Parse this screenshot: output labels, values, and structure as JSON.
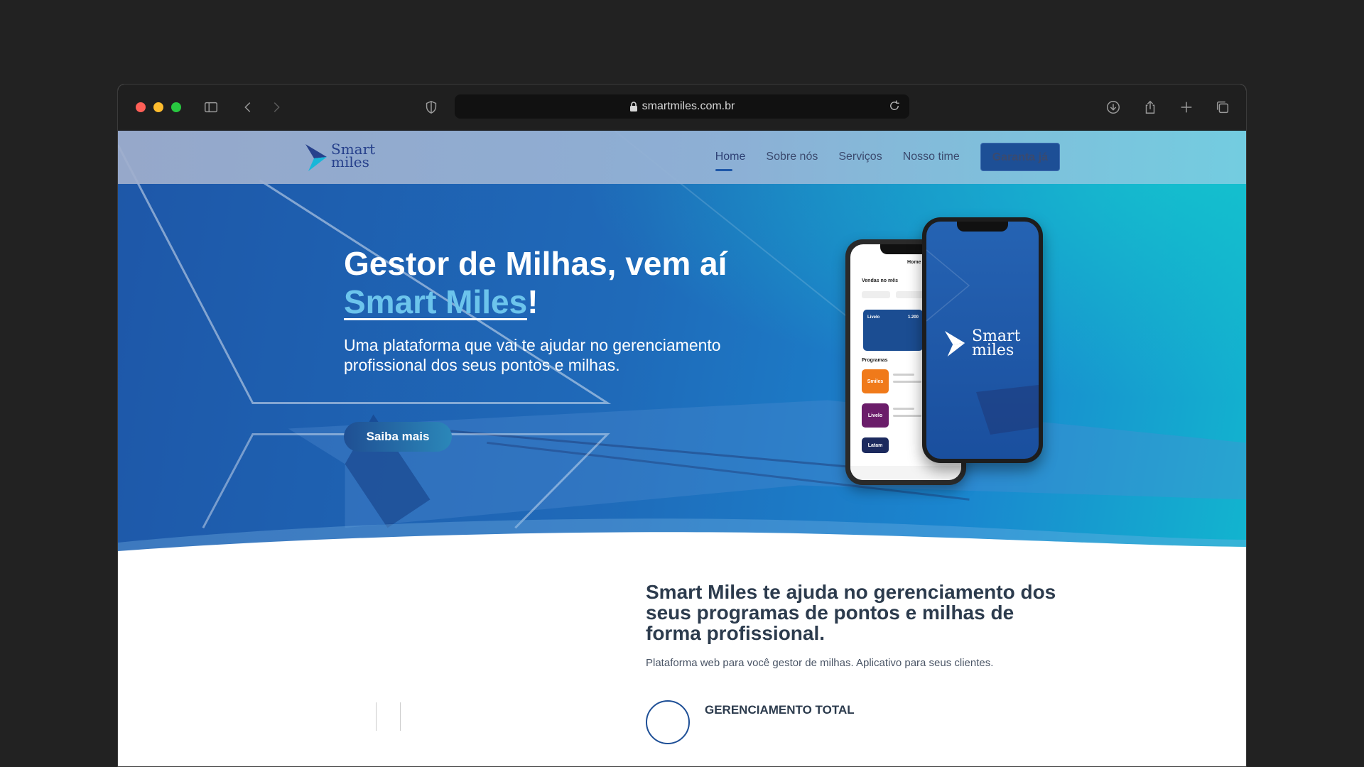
{
  "browser": {
    "url": "smartmiles.com.br"
  },
  "site": {
    "logo": {
      "line1": "Smart",
      "line2": "miles"
    },
    "nav": {
      "items": [
        "Home",
        "Sobre nós",
        "Serviços",
        "Nosso time"
      ],
      "cta": "Garanta já"
    },
    "hero": {
      "title_line1": "Gestor de Milhas, vem aí",
      "title_accent": "Smart Miles",
      "title_suffix": "!",
      "subtitle": "Uma plataforma que vai te ajudar no gerenciamento profissional dos seus pontos e milhas.",
      "button": "Saiba mais"
    },
    "section": {
      "title": "Smart Miles te ajuda no gerenciamento dos seus programas de pontos e milhas de forma profissional.",
      "subtitle": "Plataforma web para você gestor de milhas. Aplicativo para seus clientes.",
      "feature_title": "GERENCIAMENTO TOTAL"
    },
    "phone_app": {
      "header": "Home",
      "sales_label": "Vendas no mês",
      "card_name": "Livelo",
      "card_value": "1.200",
      "programs_label": "Programas",
      "programs": [
        "Smiles",
        "Livelo",
        "Latam"
      ]
    }
  },
  "colors": {
    "hero_dark": "#1e57a8",
    "hero_teal": "#12b5cf",
    "accent_text": "#6cc4ec",
    "cta_bg": "#1d4f96"
  }
}
